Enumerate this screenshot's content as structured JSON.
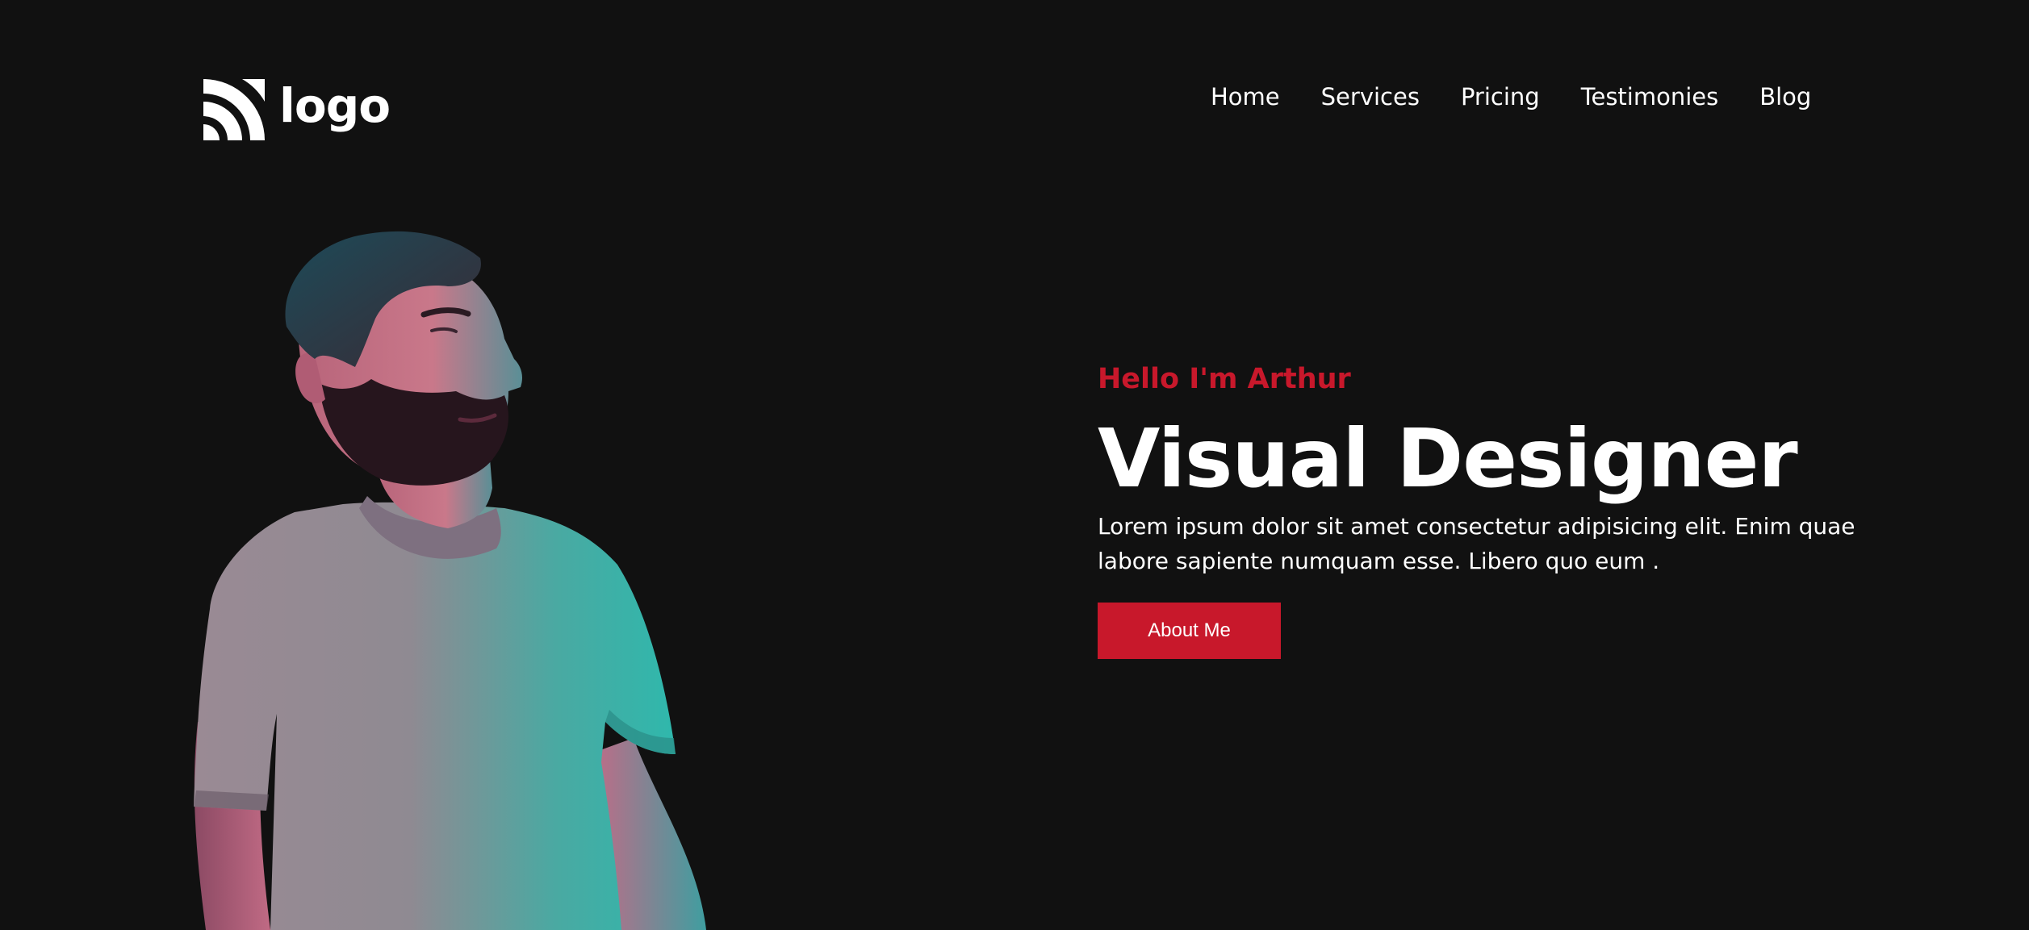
{
  "brand": {
    "logo_text": "logo",
    "accent_color": "#c8182b",
    "background_color": "#111111"
  },
  "nav": {
    "items": [
      {
        "label": "Home"
      },
      {
        "label": "Services"
      },
      {
        "label": "Pricing"
      },
      {
        "label": "Testimonies"
      },
      {
        "label": "Blog"
      }
    ]
  },
  "hero": {
    "eyebrow": "Hello I'm Arthur",
    "headline": "Visual Designer",
    "lead": "Lorem ipsum dolor sit amet consectetur adipisicing elit. Enim quae labore sapiente numquam esse. Libero quo eum .",
    "cta_label": "About Me",
    "portrait_icon": "person-photo"
  }
}
